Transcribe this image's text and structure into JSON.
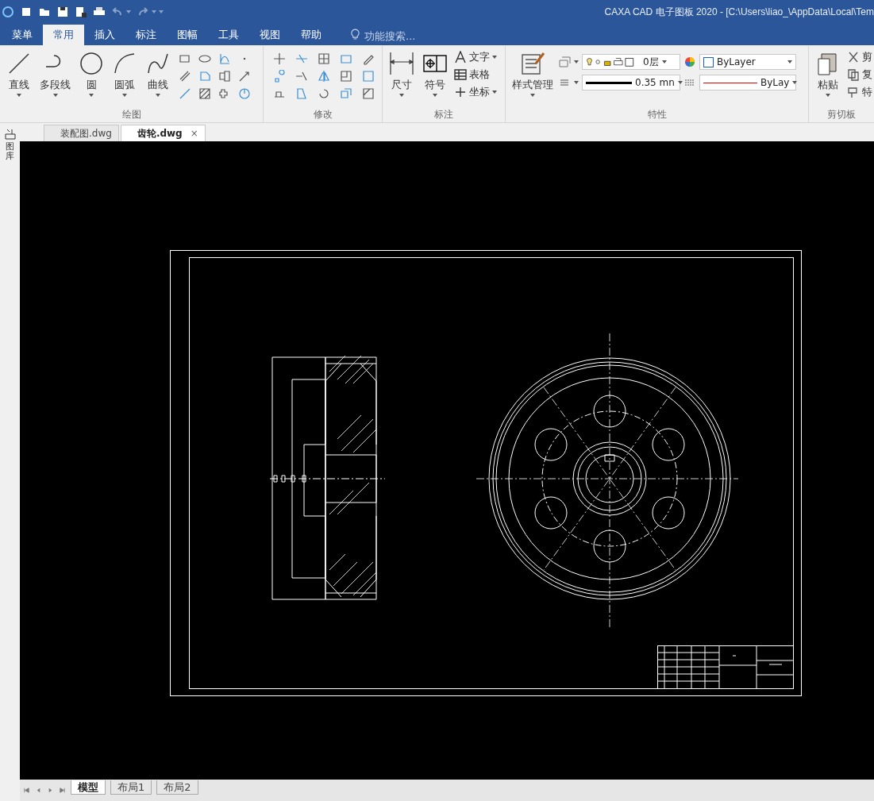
{
  "title_bar": {
    "title": "CAXA CAD 电子图板 2020 - [C:\\Users\\liao_\\AppData\\Local\\Tem"
  },
  "menu_tabs": [
    {
      "label": "菜单",
      "selected": false
    },
    {
      "label": "常用",
      "selected": true
    },
    {
      "label": "插入",
      "selected": false
    },
    {
      "label": "标注",
      "selected": false
    },
    {
      "label": "图幅",
      "selected": false
    },
    {
      "label": "工具",
      "selected": false
    },
    {
      "label": "视图",
      "selected": false
    },
    {
      "label": "帮助",
      "selected": false
    }
  ],
  "search": {
    "placeholder": "功能搜索..."
  },
  "draw_group": {
    "title": "绘图",
    "buttons": [
      "直线",
      "多段线",
      "圆",
      "圆弧",
      "曲线"
    ]
  },
  "modify_group": {
    "title": "修改"
  },
  "annotate_group": {
    "title": "标注",
    "buttons": [
      "尺寸",
      "符号"
    ],
    "small_buttons": [
      "文字",
      "表格",
      "坐标"
    ]
  },
  "properties_group": {
    "title": "特性",
    "style_button": "样式管理",
    "layer": "0层",
    "color_setting": "ByLayer",
    "line_width": "0.35 mn",
    "line_type": "ByLay"
  },
  "clipboard_group": {
    "title": "剪切板",
    "button": "粘贴",
    "small_buttons": [
      "剪",
      "复",
      "特"
    ]
  },
  "side_panel": {
    "label": "图库"
  },
  "document_tabs": [
    {
      "label": "装配图.dwg",
      "selected": false
    },
    {
      "label": "齿轮.dwg",
      "selected": true,
      "close": "×"
    }
  ],
  "layout_tabs": [
    {
      "label": "模型",
      "selected": true
    },
    {
      "label": "布局1",
      "selected": false
    },
    {
      "label": "布局2",
      "selected": false
    }
  ]
}
